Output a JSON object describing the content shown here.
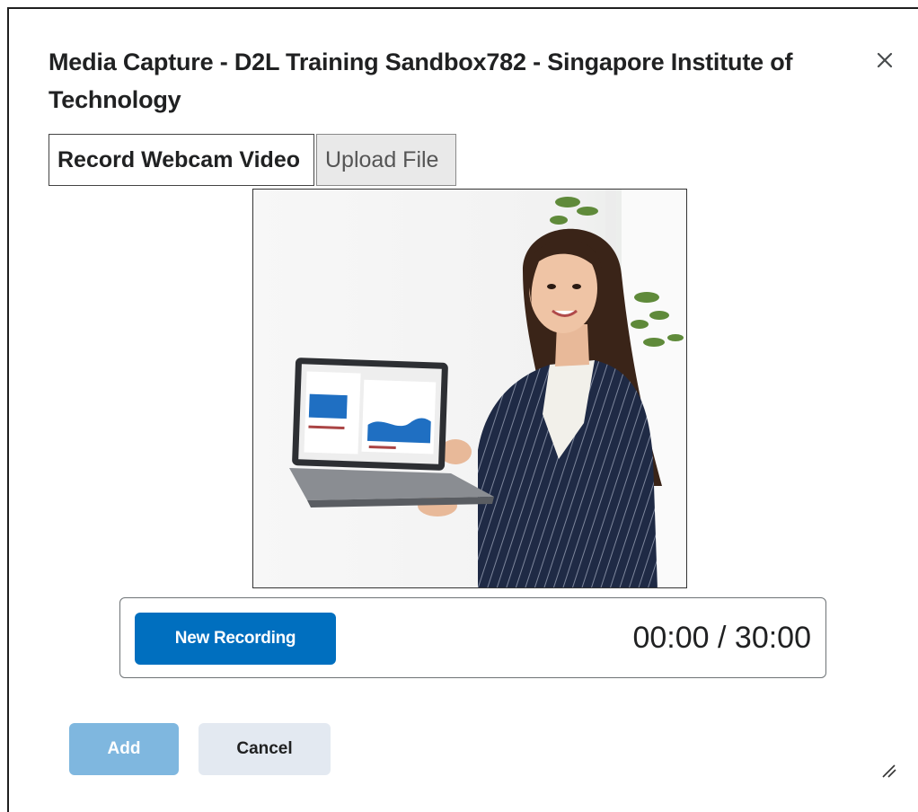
{
  "dialog": {
    "title": "Media Capture - D2L Training Sandbox782 - Singapore Institute of Technology",
    "close_icon": "close-icon"
  },
  "tabs": [
    {
      "label": "Record Webcam Video",
      "selected": true
    },
    {
      "label": "Upload File",
      "selected": false
    }
  ],
  "preview": {
    "icon": "webcam-preview-image"
  },
  "recorder": {
    "new_recording_label": "New Recording",
    "timer": "00:00 / 30:00"
  },
  "footer": {
    "add_label": "Add",
    "cancel_label": "Cancel",
    "resize_icon": "resize-handle-icon"
  },
  "colors": {
    "primary": "#006fbf",
    "primary_disabled": "#7fb7df",
    "secondary": "#e3e9f1",
    "text": "#202122"
  }
}
